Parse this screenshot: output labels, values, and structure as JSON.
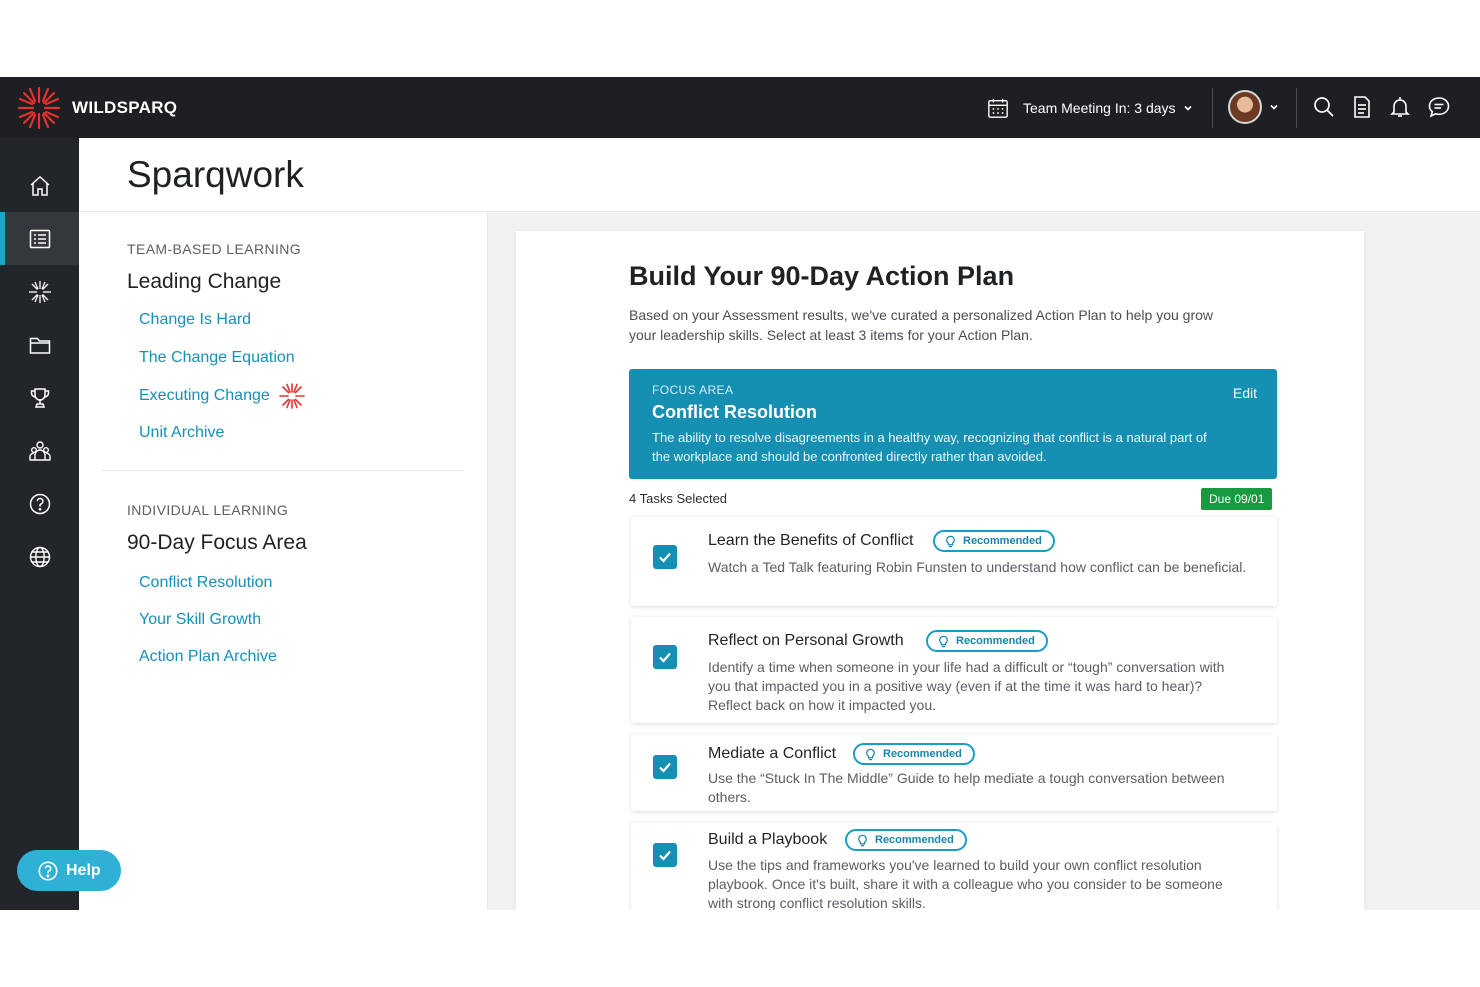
{
  "brand": {
    "name": "WILDSPARQ",
    "logo_icon": "spark-logo-icon",
    "accent": "#e5312e"
  },
  "topbar": {
    "meeting_label": "Team Meeting In: 3 days",
    "icons": [
      "calendar-icon",
      "search-icon",
      "document-icon",
      "bell-icon",
      "chat-icon"
    ]
  },
  "rail": {
    "items": [
      "home-icon",
      "sparqwork-icon",
      "spark-icon",
      "folder-icon",
      "trophy-icon",
      "team-icon",
      "question-icon",
      "globe-icon"
    ],
    "active": "sparqwork-icon"
  },
  "help": {
    "label": "Help"
  },
  "page": {
    "title": "Sparqwork"
  },
  "leftnav": {
    "team": {
      "label": "TEAM-BASED LEARNING",
      "title": "Leading Change",
      "links": [
        "Change Is Hard",
        "The Change Equation",
        "Executing Change",
        "Unit Archive"
      ]
    },
    "individual": {
      "label": "INDIVIDUAL LEARNING",
      "title": "90-Day Focus Area",
      "links": [
        "Conflict Resolution",
        "Your Skill Growth",
        "Action Plan Archive"
      ]
    }
  },
  "plan": {
    "title": "Build Your 90-Day Action Plan",
    "intro": "Based on your Assessment results, we've curated a personalized Action Plan to help you grow your leadership skills. Select at least 3 items for your Action Plan.",
    "focus": {
      "label": "FOCUS AREA",
      "title": "Conflict Resolution",
      "description": "The ability to resolve disagreements in a healthy way, recognizing that conflict is a natural part of the workplace and should be confronted directly rather than avoided.",
      "edit_label": "Edit"
    },
    "tasks_selected": "4 Tasks Selected",
    "due": "Due 09/01",
    "recommended_label": "Recommended",
    "tasks": [
      {
        "title": "Learn the Benefits of Conflict",
        "description": "Watch a Ted Talk featuring Robin Funsten to understand how conflict can be beneficial.",
        "checked": true
      },
      {
        "title": "Reflect on Personal Growth",
        "description": "Identify a time when someone in your life had a difficult or “tough” conversation with you that impacted you in a positive way (even if at the time it was hard to hear)? Reflect back on how it impacted you.",
        "checked": true
      },
      {
        "title": "Mediate a Conflict",
        "description": "Use the “Stuck In The Middle” Guide to help mediate a tough conversation between others.",
        "checked": true
      },
      {
        "title": "Build a Playbook",
        "description": "Use the tips and frameworks you've learned to build your own conflict resolution playbook. Once it's built, share it with a colleague who you consider to be someone with strong conflict resolution skills.",
        "checked": true
      }
    ]
  }
}
